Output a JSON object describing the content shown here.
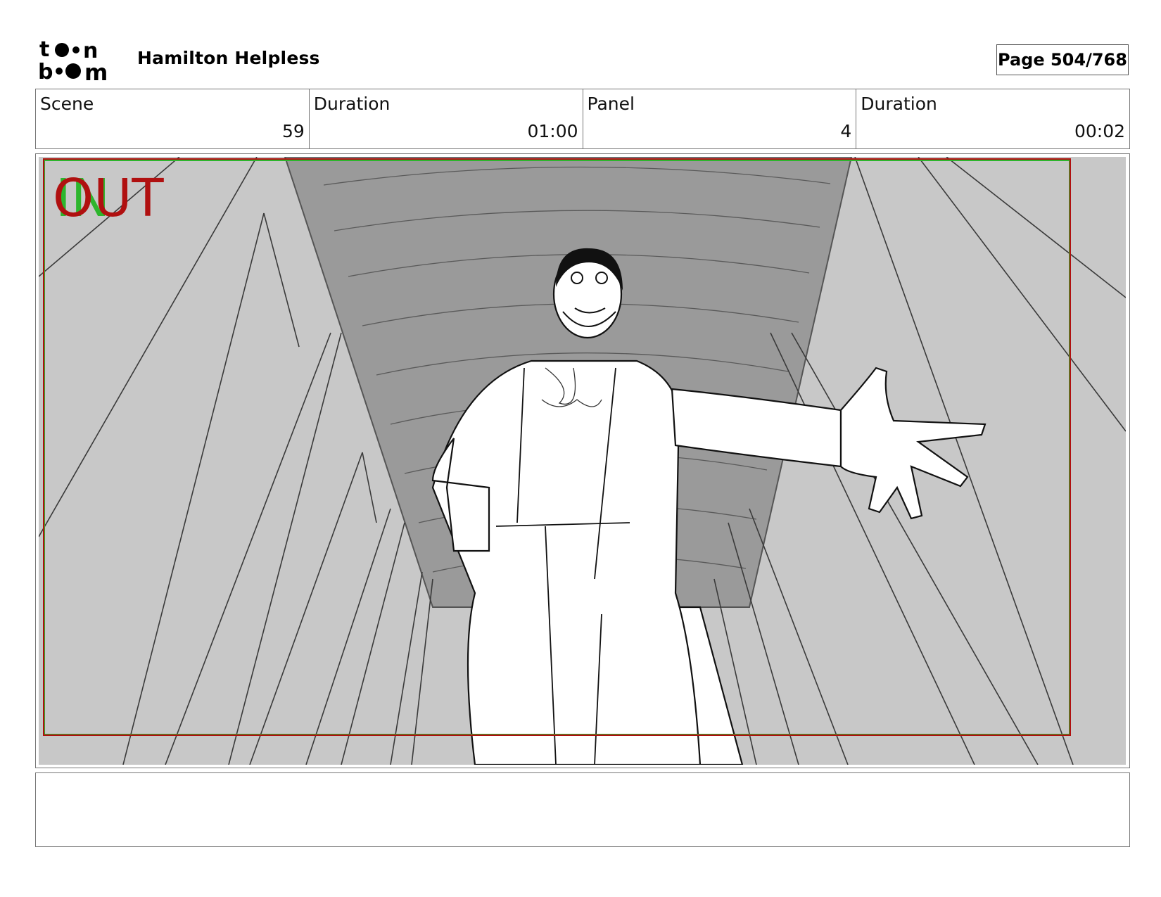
{
  "header": {
    "logo_text": "toon boom",
    "project_title": "Hamilton Helpless",
    "page_label": "Page 504/768"
  },
  "info": {
    "scene_label": "Scene",
    "scene_value": "59",
    "scene_duration_label": "Duration",
    "scene_duration_value": "01:00",
    "panel_label": "Panel",
    "panel_value": "4",
    "panel_duration_label": "Duration",
    "panel_duration_value": "00:02"
  },
  "panel": {
    "in_marker": "IN",
    "out_marker": "OUT",
    "in_color": "#2db52d",
    "out_color": "#b01010",
    "frame_color": "#b01010"
  },
  "notes": {
    "text": ""
  }
}
